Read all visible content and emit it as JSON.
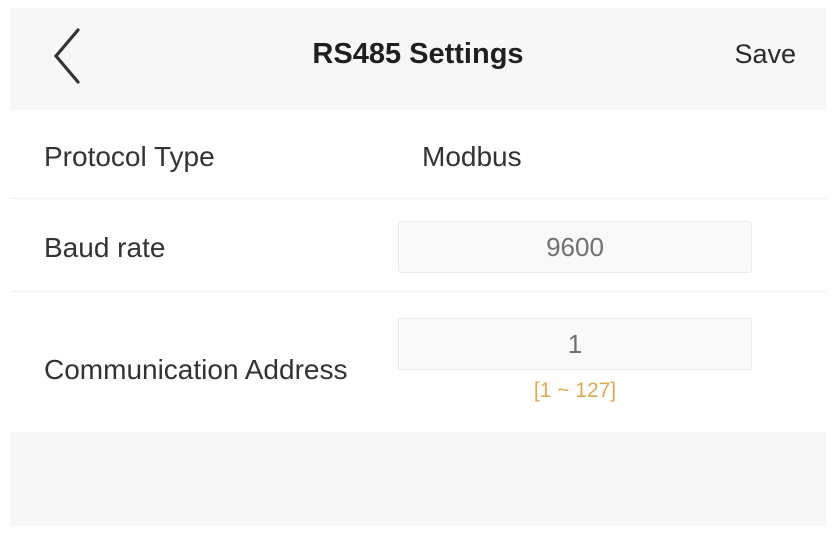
{
  "header": {
    "back_icon": "chevron-left-icon",
    "title": "RS485 Settings",
    "save_label": "Save"
  },
  "rows": {
    "protocol": {
      "label": "Protocol Type",
      "value": "Modbus"
    },
    "baud": {
      "label": "Baud rate",
      "value": "9600"
    },
    "address": {
      "label": "Communication Address",
      "value": "1",
      "hint": "[1 ~ 127]"
    }
  },
  "colors": {
    "hint": "#e0a850",
    "background": "#f7f7f7"
  }
}
